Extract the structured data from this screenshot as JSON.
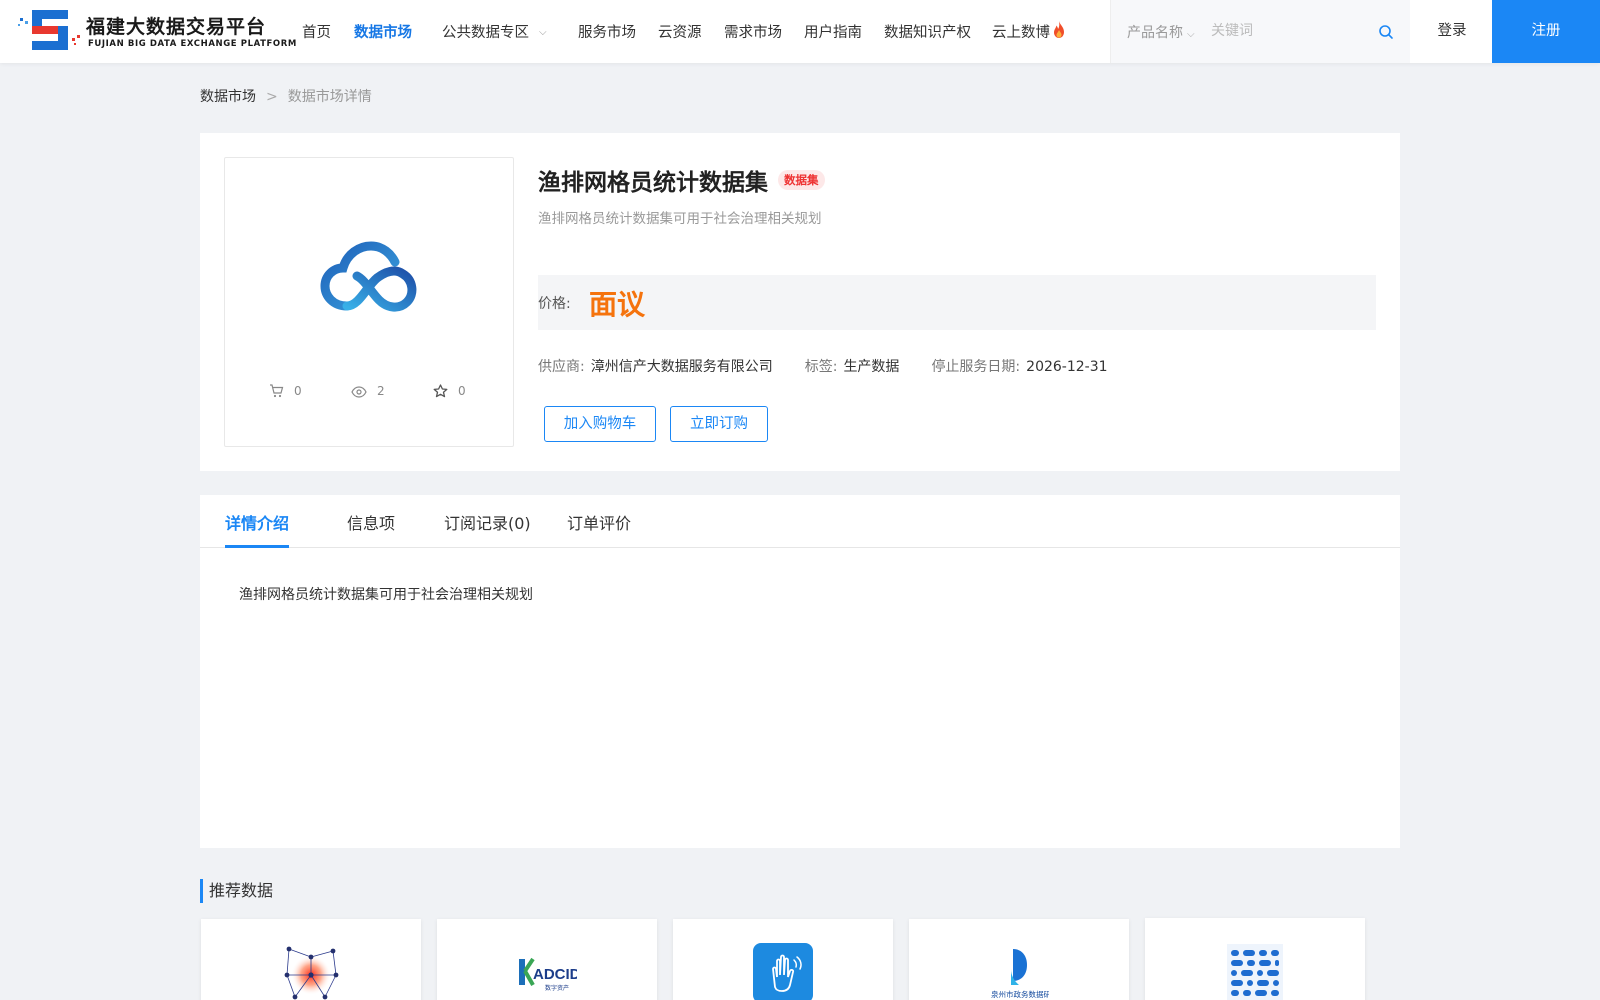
{
  "header": {
    "logo": {
      "title_cn": "福建大数据交易平台",
      "title_en": "FUJIAN BIG DATA EXCHANGE  PLATFORM"
    },
    "nav": [
      {
        "label": "首页",
        "active": false
      },
      {
        "label": "数据市场",
        "active": true
      },
      {
        "label": "公共数据专区",
        "active": false,
        "has_dropdown": true
      },
      {
        "label": "服务市场",
        "active": false
      },
      {
        "label": "云资源",
        "active": false
      },
      {
        "label": "需求市场",
        "active": false
      },
      {
        "label": "用户指南",
        "active": false
      },
      {
        "label": "数据知识产权",
        "active": false
      },
      {
        "label": "云上数博",
        "active": false,
        "icon": "fire-icon"
      }
    ],
    "search": {
      "category": "产品名称",
      "placeholder": "关键词"
    },
    "login_label": "登录",
    "register_label": "注册"
  },
  "breadcrumb": {
    "parent": "数据市场",
    "separator": ">",
    "current": "数据市场详情"
  },
  "product": {
    "title": "渔排网格员统计数据集",
    "type_badge": "数据集",
    "subtitle": "渔排网格员统计数据集可用于社会治理相关规划",
    "price_label": "价格:",
    "price_value": "面议",
    "supplier_label": "供应商:",
    "supplier": "漳州信产大数据服务有限公司",
    "tag_label": "标签:",
    "tag": "生产数据",
    "end_date_label": "停止服务日期:",
    "end_date": "2026-12-31",
    "stats": {
      "cart": "0",
      "views": "2",
      "favorites": "0"
    },
    "add_to_cart_label": "加入购物车",
    "subscribe_label": "立即订购"
  },
  "tabs": [
    {
      "label": "详情介绍",
      "active": true
    },
    {
      "label": "信息项",
      "active": false
    },
    {
      "label": "订阅记录(0)",
      "active": false
    },
    {
      "label": "订单评价",
      "active": false
    }
  ],
  "detail_text": "渔排网格员统计数据集可用于社会治理相关规划",
  "recommended": {
    "title": "推荐数据",
    "items": [
      {
        "icon": "network-graph-icon"
      },
      {
        "icon": "adcid-logo-icon"
      },
      {
        "icon": "hand-app-icon"
      },
      {
        "icon": "d-logo-icon"
      },
      {
        "icon": "dot-grid-icon"
      }
    ]
  },
  "colors": {
    "primary": "#1b87f5",
    "price": "#f5730d",
    "badge": "#ee3333"
  }
}
